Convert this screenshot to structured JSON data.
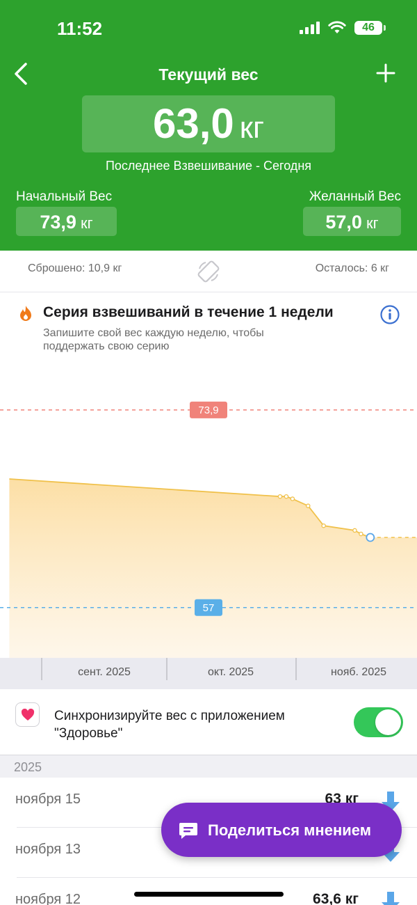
{
  "status_bar": {
    "time": "11:52",
    "battery": "46"
  },
  "header": {
    "title": "Текущий вес",
    "current_value": "63,0",
    "current_unit": "кг",
    "last_weigh_text": "Последнее Взвешивание - Сегодня",
    "start_label": "Начальный Вес",
    "start_value": "73,9",
    "start_unit": "кг",
    "goal_label": "Желанный Вес",
    "goal_value": "57,0",
    "goal_unit": "кг"
  },
  "progress": {
    "lost_text": "Сброшено: 10,9 кг",
    "remaining_text": "Осталось: 6 кг"
  },
  "streak": {
    "title": "Серия взвешиваний в течение 1 недели",
    "subtitle": "Запишите свой вес каждую неделю, чтобы поддержать свою серию"
  },
  "chart_data": {
    "type": "area",
    "reference_lines": [
      {
        "label": "73,9",
        "value": 73.9,
        "color": "#f0837a"
      },
      {
        "label": "57",
        "value": 57,
        "color": "#5aafe8"
      }
    ],
    "x_ticks": [
      "сент. 2025",
      "окт. 2025",
      "нояб. 2025"
    ],
    "ylim": [
      53.0,
      78.0
    ],
    "series": [
      {
        "x": [
          "2025-08-01",
          "2025-10-27",
          "2025-10-29",
          "2025-10-31",
          "2025-11-05",
          "2025-11-10",
          "2025-11-20",
          "2025-11-22",
          "2025-11-25"
        ],
        "values": [
          68.0,
          66.5,
          66.5,
          66.3,
          65.7,
          64.0,
          63.6,
          63.3,
          63.0
        ]
      }
    ],
    "line_color": "#f0c14b",
    "fill_color": "#fde4b6"
  },
  "health_sync": {
    "label": "Синхронизируйте вес с приложением \"Здоровье\"",
    "enabled": true
  },
  "history": {
    "year": "2025",
    "entries": [
      {
        "date": "ноября 15",
        "weight": "63 кг"
      },
      {
        "date": "ноября 13",
        "weight": ""
      },
      {
        "date": "ноября 12",
        "weight": "63,6 кг"
      }
    ]
  },
  "feedback_button": {
    "label": "Поделиться мнением"
  },
  "colors": {
    "header_green": "#2da22d",
    "feedback_purple": "#7a2fc7",
    "toggle_green": "#34c759",
    "arrow_blue": "#5aa6e8"
  }
}
